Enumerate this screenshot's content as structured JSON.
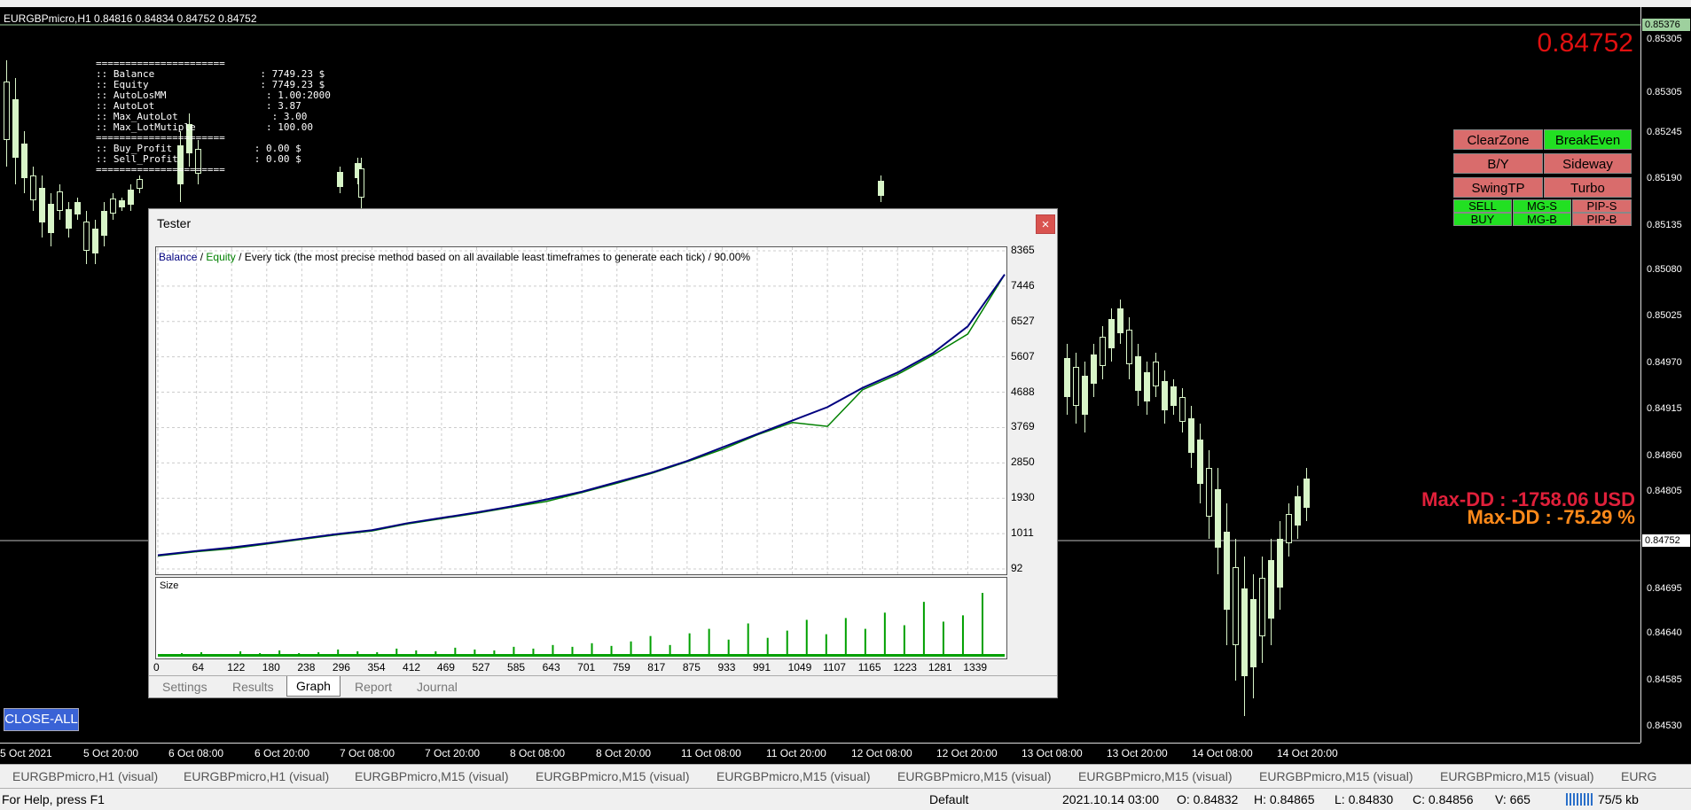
{
  "window": {
    "symbol_title": "EURGBPmicro,H1  0.84816 0.84834 0.84752 0.84752"
  },
  "info_panel": {
    "lines": [
      "======================",
      ":: Balance                  : 7749.23 $",
      ":: Equity                   : 7749.23 $",
      ":: AutoLosMM                 : 1.00:2000",
      ":: AutoLot                   : 3.87",
      ":: Max_AutoLot                : 3.00",
      ":: Max_LotMutiple            : 100.00",
      "======================",
      ":: Buy_Profit              : 0.00 $",
      ":: Sell_Profit             : 0.00 $",
      "======================"
    ]
  },
  "price_display": "0.84752",
  "buttons": {
    "clearzone": "ClearZone",
    "breakeven": "BreakEven",
    "by": "B/Y",
    "sideway": "Sideway",
    "swingtp": "SwingTP",
    "turbo": "Turbo",
    "sell": "SELL",
    "mg_s": "MG-S",
    "pip_s": "PIP-S",
    "buy": "BUY",
    "mg_b": "MG-B",
    "pip_b": "PIP-B",
    "close_all": "CLOSE-ALL"
  },
  "max_dd": {
    "usd": "Max-DD :  -1758.06 USD",
    "pct": "Max-DD :  -75.29    %"
  },
  "price_axis": {
    "ticks": [
      "0.85376",
      "0.85305",
      "0.85245",
      "0.85190",
      "0.85135",
      "0.85080",
      "0.85025",
      "0.84970",
      "0.84915",
      "0.84860",
      "0.84805",
      "0.84752",
      "0.84695",
      "0.84640",
      "0.84585",
      "0.84530"
    ],
    "top_tag": "0.85376",
    "current_tag": "0.84752"
  },
  "time_axis": [
    "5 Oct 2021",
    "5 Oct 20:00",
    "6 Oct 08:00",
    "6 Oct 20:00",
    "7 Oct 08:00",
    "7 Oct 20:00",
    "8 Oct 08:00",
    "8 Oct 20:00",
    "11 Oct 08:00",
    "11 Oct 20:00",
    "12 Oct 08:00",
    "12 Oct 20:00",
    "13 Oct 08:00",
    "13 Oct 20:00",
    "14 Oct 08:00",
    "14 Oct 20:00"
  ],
  "chart_tabs": [
    "EURGBPmicro,H1 (visual)",
    "EURGBPmicro,H1 (visual)",
    "EURGBPmicro,M15 (visual)",
    "EURGBPmicro,M15 (visual)",
    "EURGBPmicro,M15 (visual)",
    "EURGBPmicro,M15 (visual)",
    "EURGBPmicro,M15 (visual)",
    "EURGBPmicro,M15 (visual)",
    "EURGBPmicro,M15 (visual)",
    "EURG"
  ],
  "status": {
    "help": "For Help, press F1",
    "profile": "Default",
    "datetime": "2021.10.14 03:00",
    "open": "O: 0.84832",
    "high": "H: 0.84865",
    "low": "L: 0.84830",
    "close": "C: 0.84856",
    "volume": "V: 665",
    "traffic": "75/5 kb"
  },
  "tester": {
    "title": "Tester",
    "close_label": "×",
    "legend_balance": "Balance",
    "legend_sep": " / ",
    "legend_equity": "Equity",
    "legend_rest": " / Every tick (the most precise method based on all available least timeframes to generate each tick) / 90.00%",
    "size_label": "Size",
    "tabs": [
      "Settings",
      "Results",
      "Graph",
      "Report",
      "Journal"
    ],
    "active_tab": "Graph",
    "colors": {
      "balance": "#00007f",
      "equity": "#008000",
      "size": "#00a000"
    }
  },
  "chart_data": {
    "type": "line",
    "x": [
      0,
      64,
      122,
      180,
      238,
      296,
      354,
      412,
      469,
      527,
      585,
      643,
      701,
      759,
      817,
      875,
      933,
      991,
      1049,
      1107,
      1165,
      1223,
      1281,
      1339,
      1400
    ],
    "series": [
      {
        "name": "Balance",
        "values": [
          450,
          560,
          650,
          760,
          880,
          1000,
          1100,
          1280,
          1420,
          1560,
          1720,
          1900,
          2100,
          2350,
          2600,
          2900,
          3250,
          3600,
          3950,
          4300,
          4800,
          5200,
          5700,
          6400,
          7749
        ]
      },
      {
        "name": "Equity",
        "values": [
          430,
          540,
          620,
          740,
          860,
          980,
          1080,
          1260,
          1400,
          1540,
          1700,
          1850,
          2080,
          2320,
          2580,
          2880,
          3200,
          3580,
          3900,
          3800,
          4750,
          5150,
          5650,
          6200,
          7749
        ]
      }
    ],
    "y_ticks": [
      "8365",
      "7446",
      "6527",
      "5607",
      "4688",
      "3769",
      "2850",
      "1930",
      "1011",
      "92"
    ],
    "x_ticks": [
      "0",
      "64",
      "122",
      "180",
      "238",
      "296",
      "354",
      "412",
      "469",
      "527",
      "585",
      "643",
      "701",
      "759",
      "817",
      "875",
      "933",
      "991",
      "1049",
      "1107",
      "1165",
      "1223",
      "1281",
      "1339"
    ],
    "ylim": [
      92,
      8365
    ],
    "xlim": [
      0,
      1400
    ],
    "grid": true,
    "size_values": [
      2,
      3,
      4,
      2,
      5,
      3,
      6,
      3,
      4,
      7,
      5,
      4,
      8,
      6,
      5,
      9,
      7,
      6,
      10,
      8,
      12,
      10,
      14,
      11,
      16,
      22,
      12,
      25,
      30,
      18,
      36,
      20,
      28,
      40,
      24,
      42,
      30,
      48,
      34,
      60,
      38,
      45,
      70
    ]
  }
}
